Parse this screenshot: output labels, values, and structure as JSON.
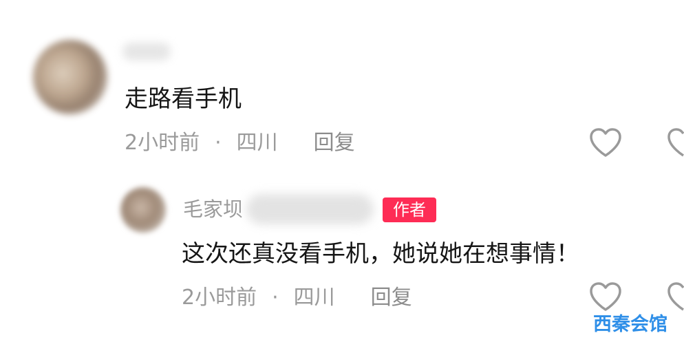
{
  "comment": {
    "text": "走路看手机",
    "time": "2小时前",
    "separator": "·",
    "location": "四川",
    "reply_label": "回复",
    "icons": {
      "avatar": "avatar-blurred",
      "like": "heart-outline-icon"
    }
  },
  "reply": {
    "author_name": "毛家坝",
    "author_badge": "作者",
    "text": "这次还真没看手机，她说她在想事情！",
    "time": "2小时前",
    "separator": "·",
    "location": "四川",
    "reply_label": "回复",
    "icons": {
      "avatar": "avatar-blurred",
      "like": "heart-outline-icon"
    }
  },
  "watermark": {
    "text": "西秦会馆"
  },
  "colors": {
    "background": "#ffffff",
    "primary_text": "#151515",
    "secondary_text": "#9a9a9a",
    "badge": "#fe2c55",
    "watermark": "#2f8fe8"
  }
}
